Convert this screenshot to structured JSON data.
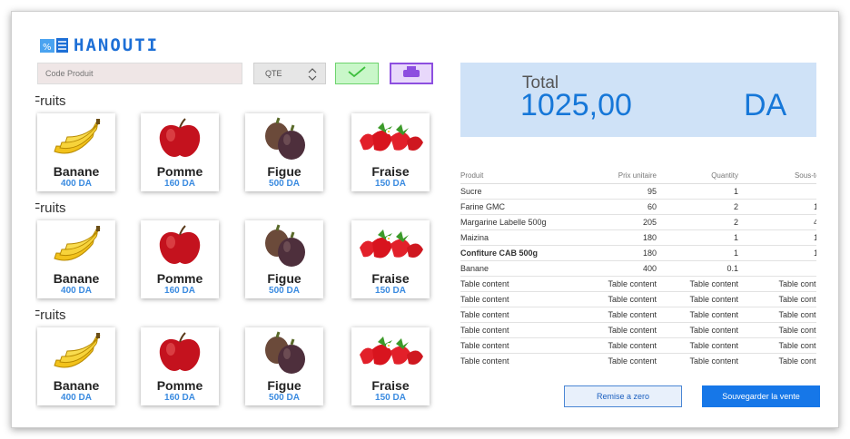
{
  "app": {
    "logo_text": "HANOUTI"
  },
  "controls": {
    "code_placeholder": "Code Produit",
    "qte_label": "QTE",
    "confirm_icon": "check-icon",
    "print_icon": "printer-icon"
  },
  "sections": [
    {
      "title": "Fruits",
      "products": [
        {
          "name": "Banane",
          "price": "400 DA",
          "icon": "banana"
        },
        {
          "name": "Pomme",
          "price": "160 DA",
          "icon": "apple"
        },
        {
          "name": "Figue",
          "price": "500 DA",
          "icon": "fig"
        },
        {
          "name": "Fraise",
          "price": "150 DA",
          "icon": "strawberry"
        }
      ]
    },
    {
      "title": "Fruits",
      "products": [
        {
          "name": "Banane",
          "price": "400 DA",
          "icon": "banana"
        },
        {
          "name": "Pomme",
          "price": "160 DA",
          "icon": "apple"
        },
        {
          "name": "Figue",
          "price": "500 DA",
          "icon": "fig"
        },
        {
          "name": "Fraise",
          "price": "150 DA",
          "icon": "strawberry"
        }
      ]
    },
    {
      "title": "Fruits",
      "products": [
        {
          "name": "Banane",
          "price": "400 DA",
          "icon": "banana"
        },
        {
          "name": "Pomme",
          "price": "160 DA",
          "icon": "apple"
        },
        {
          "name": "Figue",
          "price": "500 DA",
          "icon": "fig"
        },
        {
          "name": "Fraise",
          "price": "150 DA",
          "icon": "strawberry"
        }
      ]
    }
  ],
  "total": {
    "label": "Total",
    "value": "1025,00",
    "currency": "DA"
  },
  "table": {
    "headers": [
      "Produit",
      "Prix unitaire",
      "Quantity",
      "Sous-total"
    ],
    "rows": [
      [
        "Sucre",
        "95",
        "1",
        "95"
      ],
      [
        "Farine GMC",
        "60",
        "2",
        "120"
      ],
      [
        "Margarine Labelle 500g",
        "205",
        "2",
        "410"
      ],
      [
        "Maizina",
        "180",
        "1",
        "180"
      ],
      [
        "Confiture CAB 500g",
        "180",
        "1",
        "180"
      ],
      [
        "Banane",
        "400",
        "0.1",
        "40"
      ],
      [
        "Table content",
        "Table content",
        "Table content",
        "Table content"
      ],
      [
        "Table content",
        "Table content",
        "Table content",
        "Table content"
      ],
      [
        "Table content",
        "Table content",
        "Table content",
        "Table content"
      ],
      [
        "Table content",
        "Table content",
        "Table content",
        "Table content"
      ],
      [
        "Table content",
        "Table content",
        "Table content",
        "Table content"
      ],
      [
        "Table content",
        "Table content",
        "Table content",
        "Table content"
      ]
    ],
    "bold_row": 4
  },
  "buttons": {
    "reset": "Remise a zero",
    "save": "Souvegarder la vente"
  },
  "colors": {
    "accent": "#1677e8",
    "total_bg": "#cfe2f7",
    "price": "#3b8be0"
  }
}
